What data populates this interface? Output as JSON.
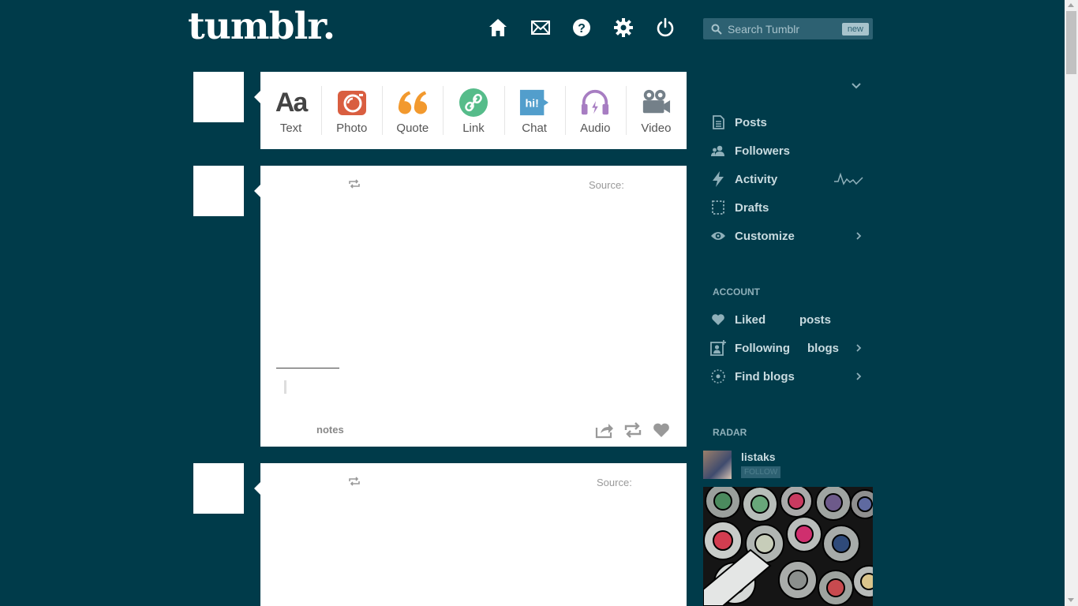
{
  "header": {
    "logo": "tumblr.",
    "search": {
      "placeholder": "Search Tumblr",
      "badge": "new"
    }
  },
  "post_types": [
    {
      "label": "Text",
      "icon": "text-icon",
      "color": "#444444"
    },
    {
      "label": "Photo",
      "icon": "camera-icon",
      "color": "#d95e40"
    },
    {
      "label": "Quote",
      "icon": "quote-icon",
      "color": "#f2992e"
    },
    {
      "label": "Link",
      "icon": "link-icon",
      "color": "#56bc8a"
    },
    {
      "label": "Chat",
      "icon": "chat-icon",
      "color": "#529ecc"
    },
    {
      "label": "Audio",
      "icon": "headphones-icon",
      "color": "#a77dc2"
    },
    {
      "label": "Video",
      "icon": "video-camera-icon",
      "color": "#748089"
    }
  ],
  "posts": [
    {
      "source_label": "Source:",
      "notes_label": "notes"
    },
    {
      "source_label": "Source:"
    }
  ],
  "sidebar": {
    "menu": [
      {
        "label": "Posts",
        "icon": "posts-icon"
      },
      {
        "label": "Followers",
        "icon": "followers-icon"
      },
      {
        "label": "Activity",
        "icon": "lightning-icon"
      },
      {
        "label": "Drafts",
        "icon": "drafts-icon"
      },
      {
        "label": "Customize",
        "icon": "eye-icon"
      }
    ],
    "account_heading": "ACCOUNT",
    "account": [
      {
        "label": "Liked",
        "label2": "posts",
        "icon": "heart-icon"
      },
      {
        "label": "Following",
        "label2": "blogs",
        "icon": "following-icon"
      },
      {
        "label": "Find blogs",
        "icon": "compass-icon"
      }
    ],
    "radar_heading": "RADAR",
    "radar": {
      "name": "listaks",
      "follow_label": "FOLLOW"
    }
  },
  "colors": {
    "background": "#003b4a",
    "search_bg": "#2d6172",
    "sidebar_text": "#c9dbe0"
  }
}
